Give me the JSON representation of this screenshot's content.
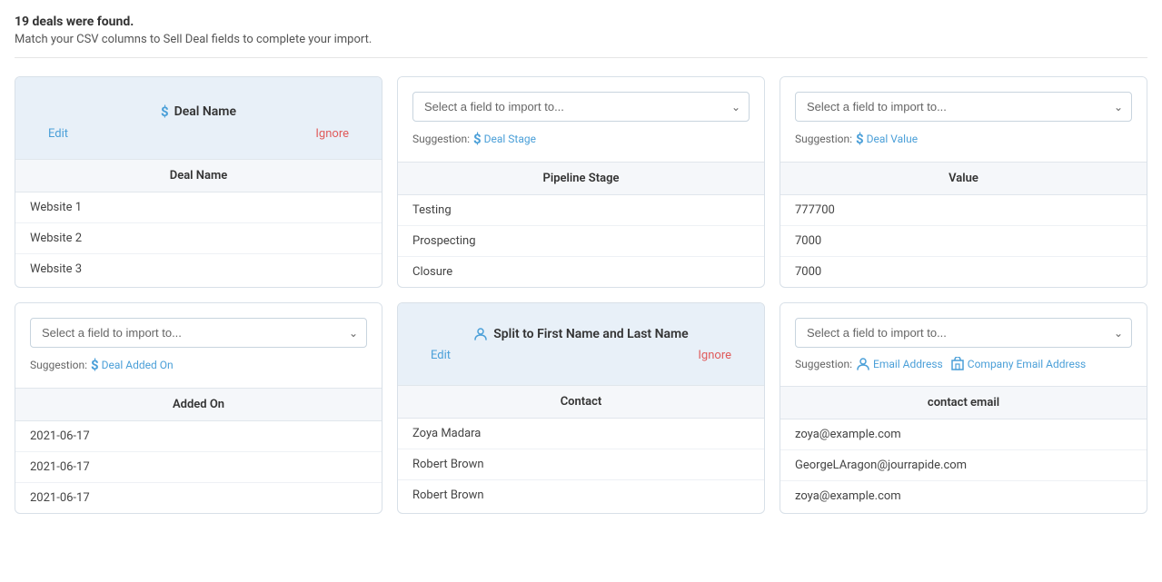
{
  "header": {
    "title": "19 deals were found.",
    "subtitle": "Match your CSV columns to Sell Deal fields to complete your import."
  },
  "cards": [
    {
      "id": "deal-name-card",
      "type": "fixed",
      "label": "Deal Name",
      "icon": "dollar",
      "editLabel": "Edit",
      "ignoreLabel": "Ignore",
      "columnHeader": "Deal Name",
      "rows": [
        "Website 1",
        "Website 2",
        "Website 3"
      ]
    },
    {
      "id": "pipeline-stage-card",
      "type": "select",
      "selectPlaceholder": "Select a field to import to...",
      "suggestionLabel": "Suggestion:",
      "suggestionItems": [
        {
          "icon": "dollar",
          "label": "Deal Stage"
        }
      ],
      "columnHeader": "Pipeline Stage",
      "rows": [
        "Testing",
        "Prospecting",
        "Closure"
      ]
    },
    {
      "id": "value-card",
      "type": "select",
      "selectPlaceholder": "Select a field to import to...",
      "suggestionLabel": "Suggestion:",
      "suggestionItems": [
        {
          "icon": "dollar",
          "label": "Deal Value"
        }
      ],
      "columnHeader": "Value",
      "rows": [
        "777700",
        "7000",
        "7000"
      ]
    },
    {
      "id": "added-on-card",
      "type": "select",
      "selectPlaceholder": "Select a field to import to...",
      "suggestionLabel": "Suggestion:",
      "suggestionItems": [
        {
          "icon": "dollar",
          "label": "Deal Added On"
        }
      ],
      "columnHeader": "Added On",
      "rows": [
        "2021-06-17",
        "2021-06-17",
        "2021-06-17"
      ]
    },
    {
      "id": "contact-card",
      "type": "split",
      "label": "Split to First Name and Last Name",
      "icon": "person",
      "editLabel": "Edit",
      "ignoreLabel": "Ignore",
      "columnHeader": "Contact",
      "rows": [
        "Zoya Madara",
        "Robert Brown",
        "Robert Brown"
      ]
    },
    {
      "id": "contact-email-card",
      "type": "select",
      "selectPlaceholder": "Select a field to import to...",
      "suggestionLabel": "Suggestion:",
      "suggestionItems": [
        {
          "icon": "person",
          "label": "Email Address"
        },
        {
          "icon": "building",
          "label": "Company Email Address"
        }
      ],
      "columnHeader": "contact email",
      "rows": [
        "zoya@example.com",
        "GeorgeLAragon@jourrapide.com",
        "zoya@example.com"
      ]
    }
  ]
}
